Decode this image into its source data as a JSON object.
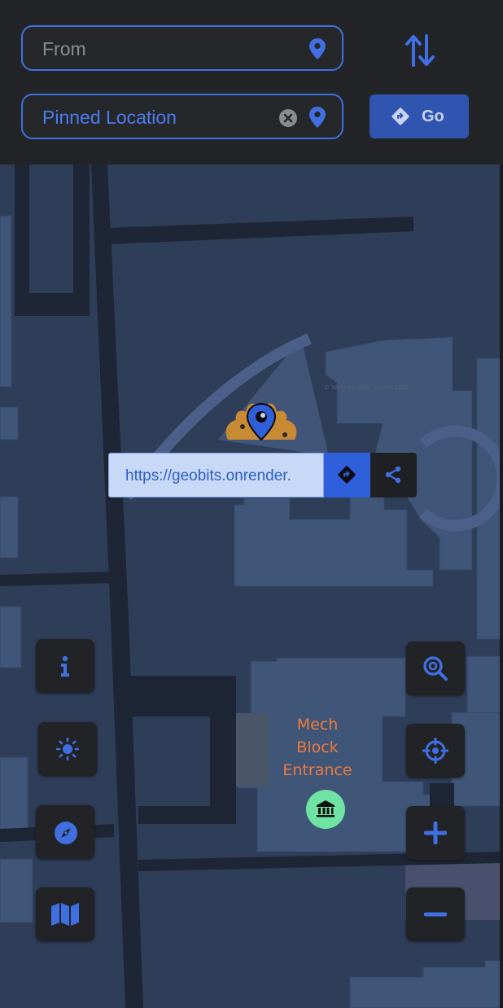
{
  "route": {
    "from_placeholder": "From",
    "destination_value": "Pinned Location",
    "go_label": "Go"
  },
  "icons": {
    "from_pin": "map-pin-icon",
    "dest_pin": "map-pin-icon",
    "clear": "circle-x-icon",
    "swap": "swap-vertical-arrows-icon",
    "go": "directions-diamond-icon",
    "directions": "directions-diamond-icon",
    "share": "share-icon",
    "info": "info-icon",
    "theme": "sun-icon",
    "compass": "compass-icon",
    "map_layers": "map-icon",
    "zoom_search": "zoom-search-icon",
    "locate": "crosshair-icon",
    "zoom_in": "plus-icon",
    "zoom_out": "minus-icon",
    "poi": "institution-building-icon"
  },
  "popup": {
    "url": "https://geobits.onrender."
  },
  "map": {
    "attribution": "© Work by Sritik & Linki 2022",
    "poi": {
      "line1": "Mech",
      "line2": "Block",
      "line3": "Entrance"
    }
  },
  "colors": {
    "accent": "#3f6fe0",
    "map_base": "#2e3d58",
    "building": "#3f5678",
    "road": "#1e2535",
    "poi_text": "#f07a3c",
    "poi_badge": "#6fe3a4",
    "marker_flower": "#c98a34"
  }
}
